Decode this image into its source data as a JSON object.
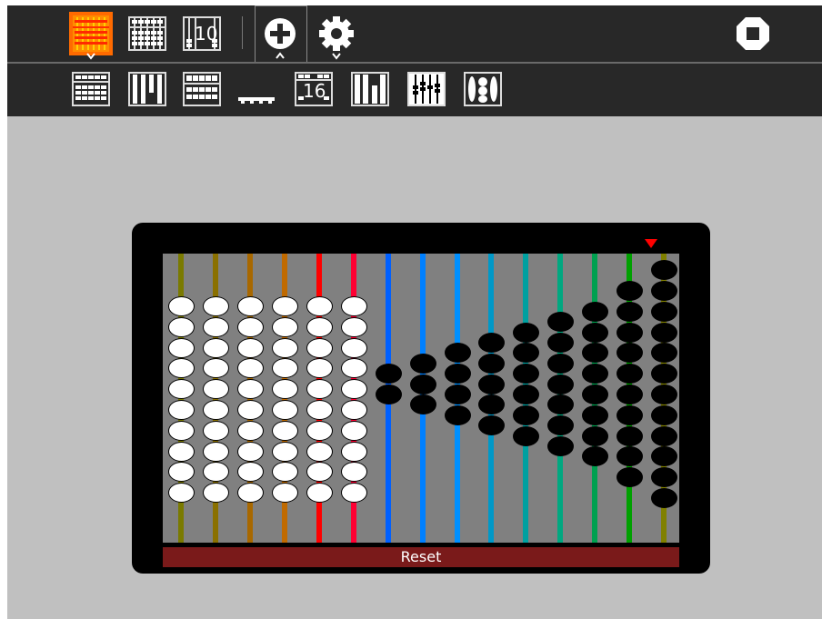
{
  "toolbar": {
    "main_buttons": [
      {
        "icon": "abacus-red-active-icon",
        "selected": true,
        "has_dropdown": true
      },
      {
        "icon": "abacus-suanpan-icon"
      },
      {
        "icon": "abacus-decimal-icon",
        "number": "10"
      }
    ],
    "add_tab": {
      "icon": "plus-circle-icon",
      "active": true
    },
    "settings": {
      "icon": "gear-icon",
      "has_dropdown": true
    },
    "stop": {
      "icon": "stop-icon"
    }
  },
  "subtoolbar": {
    "buttons": [
      {
        "icon": "abacus-soroban-icon"
      },
      {
        "icon": "abacus-schety-icon"
      },
      {
        "icon": "abacus-nepohualtzintzin-icon"
      },
      {
        "icon": "abacus-dots-icon"
      },
      {
        "icon": "abacus-hex-icon",
        "number": "16"
      },
      {
        "icon": "abacus-bars-icon"
      },
      {
        "icon": "abacus-fraction-icon"
      },
      {
        "icon": "abacus-caacupe-icon"
      }
    ]
  },
  "abacus": {
    "reset_label": "Reset",
    "rod_colors": [
      "#7a7a00",
      "#8a7000",
      "#a86800",
      "#c06a00",
      "#ff0000",
      "#ff0033",
      "#0060ff",
      "#0080ff",
      "#0090ff",
      "#0098c8",
      "#00a0a0",
      "#00a880",
      "#00a050",
      "#00a000",
      "#808000"
    ],
    "bead_counts": [
      10,
      10,
      10,
      10,
      10,
      10,
      2,
      3,
      4,
      5,
      6,
      7,
      8,
      10,
      12
    ],
    "bead_colors": [
      "white",
      "white",
      "white",
      "white",
      "white",
      "white",
      "black",
      "black",
      "black",
      "black",
      "black",
      "black",
      "black",
      "black",
      "black"
    ],
    "indicator_color": "#ff0000"
  },
  "colors": {
    "toolbar_bg": "#282828",
    "canvas_bg": "#c0c0c0",
    "frame": "#000000",
    "field": "#808080",
    "reset_bg": "#7a1a1a",
    "active_button": "#ff6a00"
  }
}
